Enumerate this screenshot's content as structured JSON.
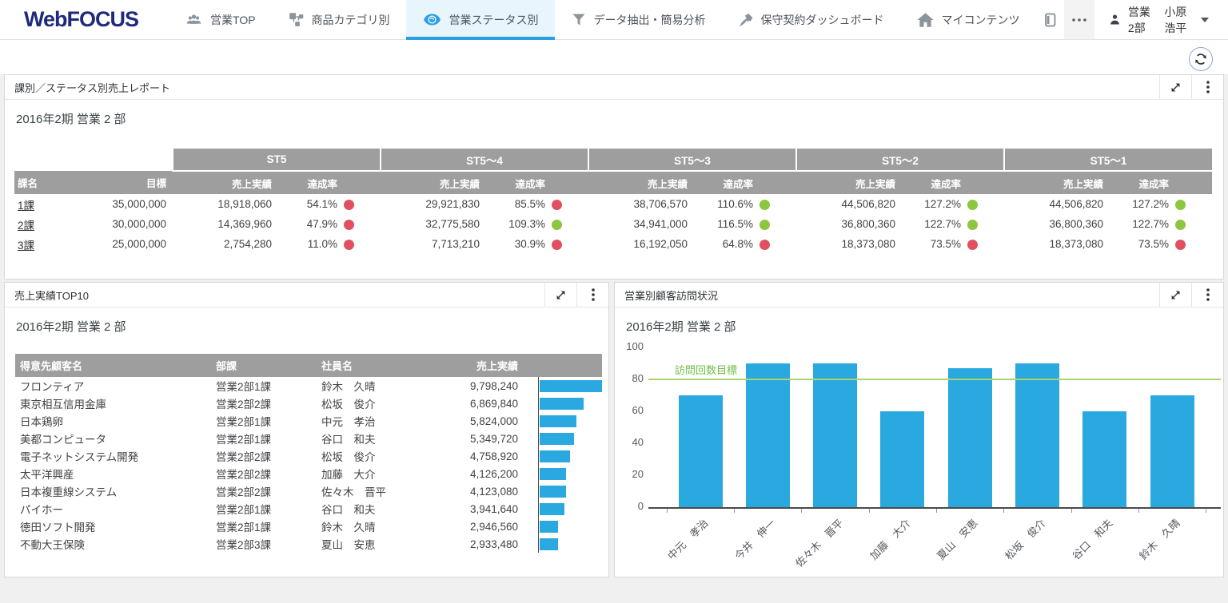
{
  "nav": {
    "logo": "WebFOCUS",
    "tabs": [
      {
        "id": "sales-top",
        "label": "営業TOP",
        "icon": "users-icon",
        "active": false
      },
      {
        "id": "product-category",
        "label": "商品カテゴリ別",
        "icon": "sitemap-icon",
        "active": false
      },
      {
        "id": "sales-status",
        "label": "営業ステータス別",
        "icon": "eye-icon",
        "active": true
      },
      {
        "id": "data-extract",
        "label": "データ抽出・簡易分析",
        "icon": "funnel-icon",
        "active": false
      },
      {
        "id": "maintenance-dashboard",
        "label": "保守契約ダッシュボード",
        "icon": "hammer-icon",
        "active": false
      },
      {
        "id": "my-content",
        "label": "マイコンテンツ",
        "icon": "home-icon",
        "active": false
      }
    ],
    "user": {
      "department": "営業2部",
      "name": "小原 浩平"
    }
  },
  "panel_status": {
    "title": "課別／ステータス別売上レポート",
    "subtitle": "2016年2期 営業 2 部",
    "groups": [
      "ST5",
      "ST5〜4",
      "ST5〜3",
      "ST5〜2",
      "ST5〜1"
    ],
    "columns": {
      "dept": "課名",
      "target": "目標",
      "sales": "売上実績",
      "rate": "達成率"
    },
    "rows": [
      {
        "dept": "1課",
        "target": "35,000,000",
        "cells": [
          {
            "sales": "18,918,060",
            "rate": "54.1%",
            "status": "red"
          },
          {
            "sales": "29,921,830",
            "rate": "85.5%",
            "status": "red"
          },
          {
            "sales": "38,706,570",
            "rate": "110.6%",
            "status": "green"
          },
          {
            "sales": "44,506,820",
            "rate": "127.2%",
            "status": "green"
          },
          {
            "sales": "44,506,820",
            "rate": "127.2%",
            "status": "green"
          }
        ]
      },
      {
        "dept": "2課",
        "target": "30,000,000",
        "cells": [
          {
            "sales": "14,369,960",
            "rate": "47.9%",
            "status": "red"
          },
          {
            "sales": "32,775,580",
            "rate": "109.3%",
            "status": "green"
          },
          {
            "sales": "34,941,000",
            "rate": "116.5%",
            "status": "green"
          },
          {
            "sales": "36,800,360",
            "rate": "122.7%",
            "status": "green"
          },
          {
            "sales": "36,800,360",
            "rate": "122.7%",
            "status": "green"
          }
        ]
      },
      {
        "dept": "3課",
        "target": "25,000,000",
        "cells": [
          {
            "sales": "2,754,280",
            "rate": "11.0%",
            "status": "red"
          },
          {
            "sales": "7,713,210",
            "rate": "30.9%",
            "status": "red"
          },
          {
            "sales": "16,192,050",
            "rate": "64.8%",
            "status": "red"
          },
          {
            "sales": "18,373,080",
            "rate": "73.5%",
            "status": "red"
          },
          {
            "sales": "18,373,080",
            "rate": "73.5%",
            "status": "red"
          }
        ]
      }
    ]
  },
  "panel_top10": {
    "title": "売上実績TOP10",
    "subtitle": "2016年2期 営業 2 部",
    "columns": [
      "得意先顧客名",
      "部課",
      "社員名",
      "売上実績"
    ],
    "bar_max_value": 9798240,
    "rows": [
      {
        "customer": "フロンティア",
        "dept": "営業2部1課",
        "employee": "鈴木　久晴",
        "sales": "9,798,240",
        "value": 9798240
      },
      {
        "customer": "東京相互信用金庫",
        "dept": "営業2部2課",
        "employee": "松坂　俊介",
        "sales": "6,869,840",
        "value": 6869840
      },
      {
        "customer": "日本鶏卵",
        "dept": "営業2部1課",
        "employee": "中元　孝治",
        "sales": "5,824,000",
        "value": 5824000
      },
      {
        "customer": "美都コンピュータ",
        "dept": "営業2部1課",
        "employee": "谷口　和夫",
        "sales": "5,349,720",
        "value": 5349720
      },
      {
        "customer": "電子ネットシステム開発",
        "dept": "営業2部2課",
        "employee": "松坂　俊介",
        "sales": "4,758,920",
        "value": 4758920
      },
      {
        "customer": "太平洋興産",
        "dept": "営業2部2課",
        "employee": "加藤　大介",
        "sales": "4,126,200",
        "value": 4126200
      },
      {
        "customer": "日本複重線システム",
        "dept": "営業2部2課",
        "employee": "佐々木　晋平",
        "sales": "4,123,080",
        "value": 4123080
      },
      {
        "customer": "パイホー",
        "dept": "営業2部1課",
        "employee": "谷口　和夫",
        "sales": "3,941,640",
        "value": 3941640
      },
      {
        "customer": "徳田ソフト開発",
        "dept": "営業2部1課",
        "employee": "鈴木　久晴",
        "sales": "2,946,560",
        "value": 2946560
      },
      {
        "customer": "不動大王保険",
        "dept": "営業2部3課",
        "employee": "夏山　安恵",
        "sales": "2,933,480",
        "value": 2933480
      }
    ]
  },
  "panel_visits": {
    "title": "営業別顧客訪問状況",
    "subtitle": "2016年2期 営業 2 部"
  },
  "chart_data": {
    "type": "bar",
    "title": "営業別顧客訪問状況",
    "subtitle": "2016年2期 営業 2 部",
    "categories": [
      "中元　孝治",
      "今井　伸一",
      "佐々木　晋平",
      "加藤　大介",
      "夏山　安恵",
      "松坂　俊介",
      "谷口　和夫",
      "鈴木　久晴"
    ],
    "values": [
      70,
      90,
      90,
      60,
      87,
      90,
      60,
      70
    ],
    "xlabel": "",
    "ylabel": "",
    "ylim": [
      0,
      100
    ],
    "yticks": [
      0,
      20,
      40,
      60,
      80,
      100
    ],
    "grid": false,
    "legend": "none",
    "reference_line": {
      "value": 80,
      "label": "訪問回数目標"
    },
    "bar_color": "#29a9df",
    "reference_color": "#a9d470"
  },
  "colors": {
    "accent_blue": "#2b9fe2",
    "logo_navy": "#202a7c",
    "header_gray": "#9e9e9e",
    "status_red": "#e0505f",
    "status_green": "#8dc63f",
    "bar_blue": "#29a9df",
    "reference_green": "#a9d470",
    "reference_text_green": "#6fbf45"
  }
}
